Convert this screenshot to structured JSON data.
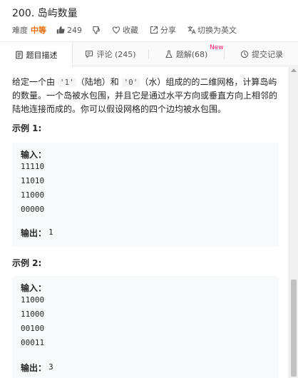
{
  "problem": {
    "title": "200. 岛屿数量",
    "difficulty_label": "难度",
    "difficulty": "中等",
    "likes": "249",
    "favorite_label": "收藏",
    "share_label": "分享",
    "lang_switch_label": "切换为英文"
  },
  "tabs": [
    {
      "label": "题目描述"
    },
    {
      "label": "评论 (245)"
    },
    {
      "label": "题解(68)"
    },
    {
      "label": "提交记录"
    }
  ],
  "new_badge": "New",
  "description": {
    "part1": "给定一个由 ",
    "code1": "'1'",
    "part2": "（陆地）和 ",
    "code2": "'0'",
    "part3": "（水）组成的的二维网格，计算岛屿的数量。一个岛被水包围，并且它是通过水平方向或垂直方向上相邻的陆地连接而成的。你可以假设网格的四个边均被水包围。"
  },
  "examples": [
    {
      "title": "示例 1:",
      "input_label": "输入：",
      "grid": [
        "11110",
        "11010",
        "11000",
        "00000"
      ],
      "output_label": "输出：",
      "output": "1"
    },
    {
      "title": "示例 2:",
      "input_label": "输入：",
      "grid": [
        "11000",
        "11000",
        "00100",
        "00011"
      ],
      "output_label": "输出：",
      "output": "3"
    }
  ],
  "icons": {
    "like": "thumbs-up-icon",
    "dislike": "thumbs-down-icon",
    "favorite": "heart-icon",
    "share": "share-icon",
    "language": "translate-icon",
    "description_tab": "document-icon",
    "comments_tab": "comment-icon",
    "solutions_tab": "flask-icon",
    "submissions_tab": "clock-icon"
  },
  "colors": {
    "difficulty_medium": "#ef6c00",
    "new_badge": "#ff1e6e",
    "example_bg": "#f7f9fa"
  }
}
